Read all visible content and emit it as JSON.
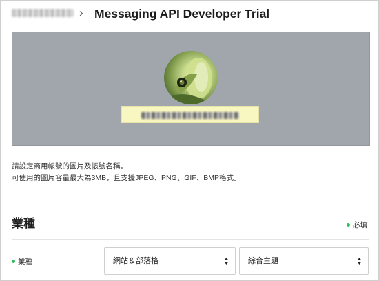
{
  "header": {
    "breadcrumb": "",
    "separator": "›",
    "title": "Messaging API Developer Trial"
  },
  "banner": {
    "background_color": "#a1a6ac",
    "avatar_icon": "frog-profile-image",
    "account_name": ""
  },
  "info": {
    "line1": "請設定商用帳號的圖片及帳號名稱。",
    "line2": "可使用的圖片容量最大為3MB，且支援JPEG、PNG、GIF、BMP格式。"
  },
  "industry": {
    "title": "業種",
    "required_label": "必填",
    "required_color": "#2dbe5d",
    "field_label": "業種",
    "select_category": "網站＆部落格",
    "select_subcategory": "綜合主題"
  }
}
